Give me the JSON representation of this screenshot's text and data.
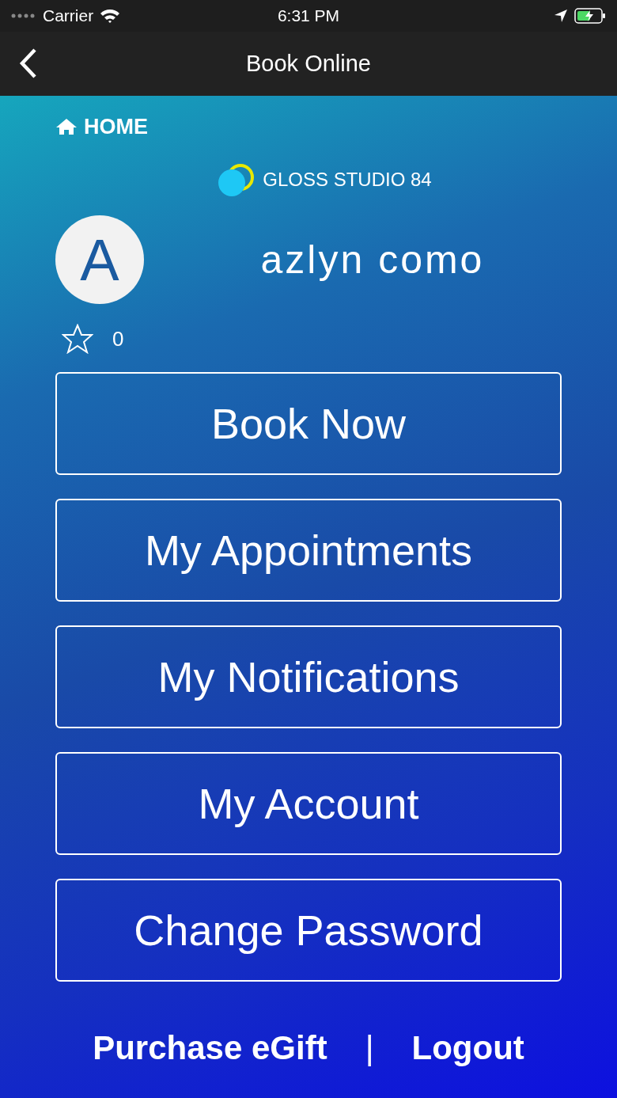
{
  "status_bar": {
    "carrier": "Carrier",
    "time": "6:31 PM"
  },
  "header": {
    "title": "Book Online"
  },
  "home_link": {
    "label": "HOME"
  },
  "logo": {
    "text": "GLOSS STUDIO 84"
  },
  "profile": {
    "avatar_letter": "A",
    "name": "azlyn como",
    "points": "0"
  },
  "buttons": [
    {
      "label": "Book Now"
    },
    {
      "label": "My Appointments"
    },
    {
      "label": "My Notifications"
    },
    {
      "label": "My Account"
    },
    {
      "label": "Change Password"
    }
  ],
  "footer": {
    "links": [
      {
        "label": "Purchase eGift"
      },
      {
        "label": "Logout"
      }
    ],
    "separator": "|"
  }
}
